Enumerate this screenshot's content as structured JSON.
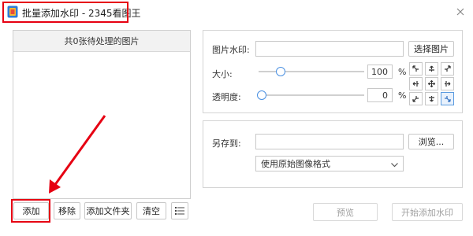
{
  "window": {
    "title": "批量添加水印 - 2345看图王",
    "icon": "app-logo-icon",
    "close_icon": "close-icon"
  },
  "left_panel": {
    "header": "共0张待处理的图片",
    "buttons": {
      "add": "添加",
      "remove": "移除",
      "add_folder": "添加文件夹",
      "clear": "清空",
      "list_icon": "list-icon"
    }
  },
  "settings": {
    "watermark_label": "图片水印:",
    "watermark_value": "",
    "choose_image": "选择图片",
    "size_label": "大小:",
    "size_value": "100",
    "size_unit": "%",
    "opacity_label": "透明度:",
    "opacity_value": "0",
    "opacity_unit": "%",
    "position_selected": "bottom-right"
  },
  "save": {
    "saveto_label": "另存到:",
    "saveto_value": "",
    "browse": "浏览...",
    "format": "使用原始图像格式"
  },
  "actions": {
    "preview": "预览",
    "start": "开始添加水印"
  },
  "colors": {
    "highlight_red": "#e60012",
    "accent_blue": "#4a90e2"
  }
}
